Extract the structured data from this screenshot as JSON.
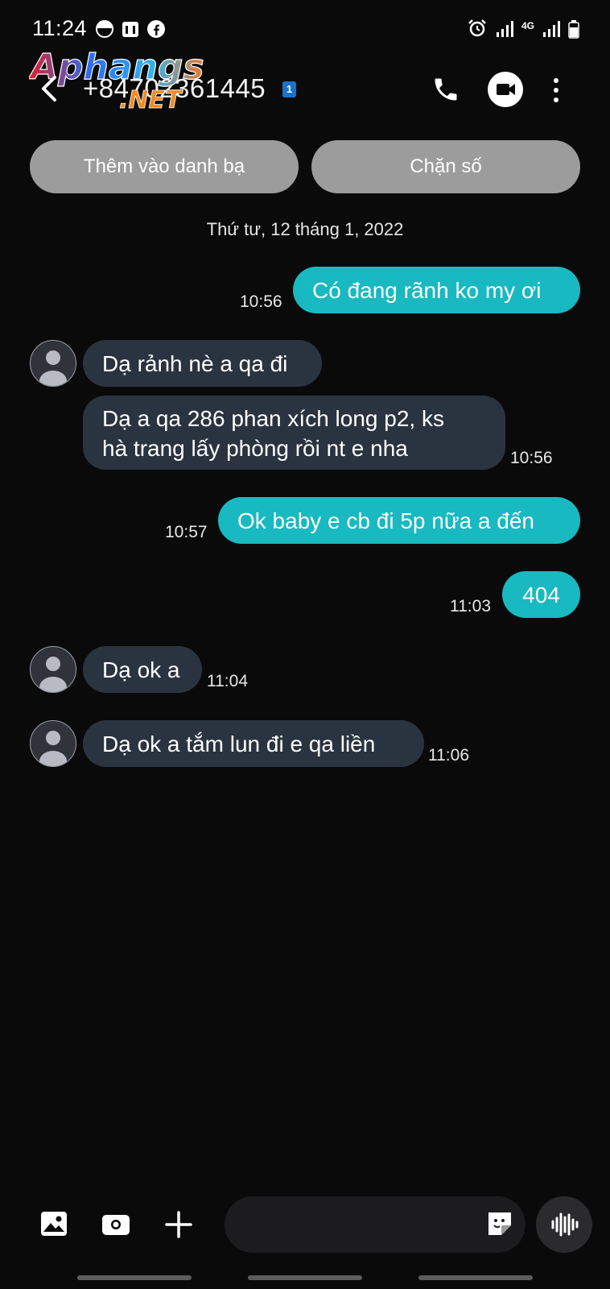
{
  "status_bar": {
    "time": "11:24",
    "network": "4G"
  },
  "watermark": {
    "line1": "Aphangs",
    "line2": ".NET"
  },
  "header": {
    "phone_number": "+84702361445",
    "sim_badge": "1"
  },
  "actions": {
    "add_contact": "Thêm vào danh bạ",
    "block": "Chặn số"
  },
  "date_separator": "Thứ tư, 12 tháng 1, 2022",
  "messages": [
    {
      "direction": "out",
      "text": "Có đang rãnh ko my ơi",
      "time": "10:56"
    },
    {
      "direction": "in",
      "text": "Dạ rảnh nè a qa đi",
      "time": ""
    },
    {
      "direction": "in",
      "lines": [
        "Dạ a qa 286 phan xích long p2, ks",
        "hà trang lấy phòng rồi nt e nha"
      ],
      "time": "10:56"
    },
    {
      "direction": "out",
      "text": "Ok baby e cb đi 5p nữa a đến",
      "time": "10:57"
    },
    {
      "direction": "out",
      "text": "404",
      "time": "11:03"
    },
    {
      "direction": "in",
      "text": "Dạ ok a",
      "time": "11:04"
    },
    {
      "direction": "in",
      "text": "Dạ ok a tắm lun đi e qa liền",
      "time": "11:06"
    }
  ],
  "colors": {
    "outgoing": "#18b9c1",
    "incoming": "#2a3440",
    "background": "#0a0a0b",
    "pill": "#9c9c9c"
  },
  "icons": [
    "back-icon",
    "call-icon",
    "video-call-icon",
    "more-options-icon",
    "gallery-icon",
    "camera-icon",
    "plus-icon",
    "sticker-icon",
    "voice-icon"
  ]
}
